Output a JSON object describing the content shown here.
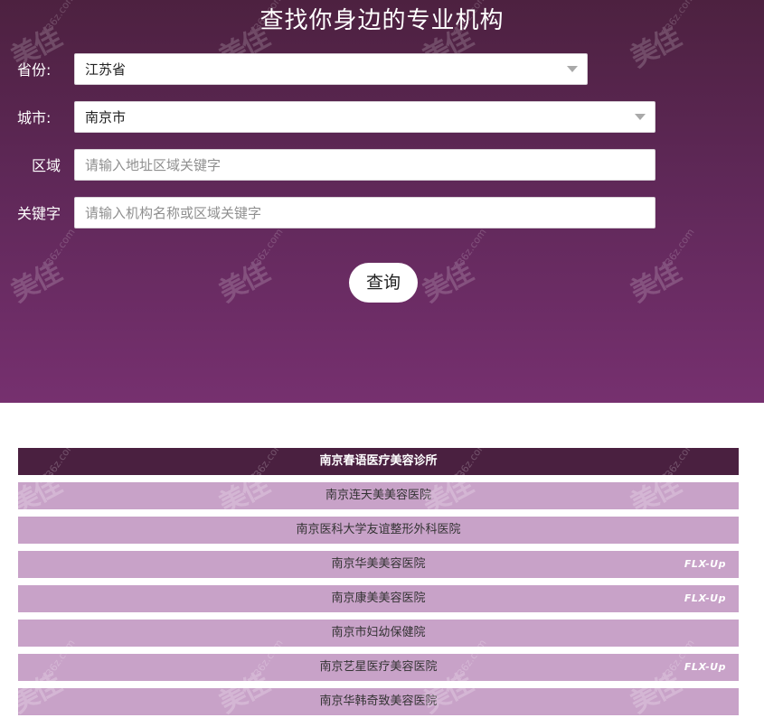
{
  "header": {
    "title": "查找你身边的专业机构"
  },
  "form": {
    "province": {
      "label": "省份:",
      "value": "江苏省"
    },
    "city": {
      "label": "城市:",
      "value": "南京市"
    },
    "area": {
      "label": "区域",
      "placeholder": "请输入地址区域关键字"
    },
    "keyword": {
      "label": "关键字",
      "placeholder": "请输入机构名称或区域关键字"
    },
    "search_label": "查询"
  },
  "watermark": {
    "logo": "美佳",
    "url": "236z.com"
  },
  "results": [
    {
      "name": "南京春语医疗美容诊所",
      "active": true,
      "badge": ""
    },
    {
      "name": "南京连天美美容医院",
      "active": false,
      "badge": ""
    },
    {
      "name": "南京医科大学友谊整形外科医院",
      "active": false,
      "badge": ""
    },
    {
      "name": "南京华美美容医院",
      "active": false,
      "badge": "FLX-Up"
    },
    {
      "name": "南京康美美容医院",
      "active": false,
      "badge": "FLX-Up"
    },
    {
      "name": "南京市妇幼保健院",
      "active": false,
      "badge": ""
    },
    {
      "name": "南京艺星医疗美容医院",
      "active": false,
      "badge": "FLX-Up"
    },
    {
      "name": "南京华韩奇致美容医院",
      "active": false,
      "badge": ""
    }
  ],
  "colors": {
    "hero_top": "#4d2140",
    "hero_bottom": "#76306f",
    "row": "#c8a2c8",
    "row_active": "#4a2040"
  }
}
